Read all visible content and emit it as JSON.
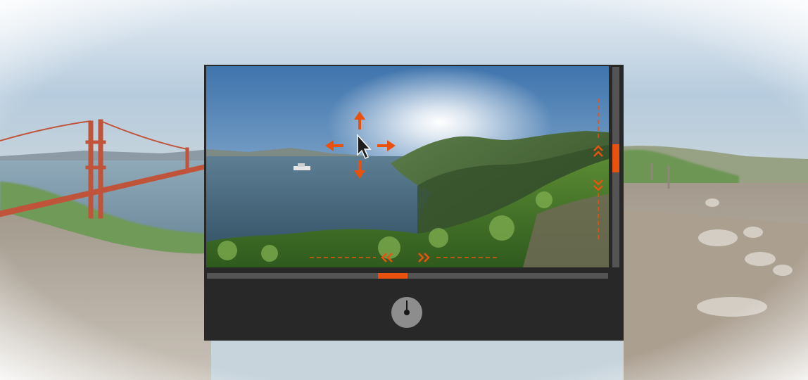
{
  "viewer": {
    "navigation_arrows": [
      "arrow-up-icon",
      "arrow-down-icon",
      "arrow-left-icon",
      "arrow-right-icon"
    ],
    "cursor_icon": "mouse-pointer-icon",
    "pan_hint_icons": [
      "chevrons-left-icon",
      "chevrons-right-icon",
      "chevrons-up-icon",
      "chevrons-down-icon"
    ],
    "vertical_scrollbar_position": 0.45,
    "horizontal_scrollbar_position": 0.46,
    "compass_heading_degrees": 0
  },
  "colors": {
    "accent": "#e8520e",
    "panel_background": "#282828",
    "track": "#545454",
    "compass_dial": "#8d8d8d"
  }
}
